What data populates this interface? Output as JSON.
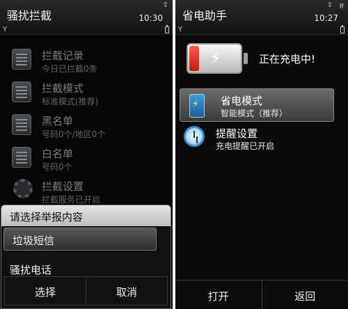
{
  "left": {
    "title": "骚扰拦截",
    "time": "10:30",
    "items": [
      {
        "title": "拦截记录",
        "subtitle": "今日已拦截0条"
      },
      {
        "title": "拦截模式",
        "subtitle": "标准模式(推荐)"
      },
      {
        "title": "黑名单",
        "subtitle": "号码0个/地区0个"
      },
      {
        "title": "白名单",
        "subtitle": "号码0个"
      },
      {
        "title": "拦截设置",
        "subtitle": "拦截服务已开启"
      }
    ],
    "popup": {
      "heading": "请选择举报内容",
      "options": [
        "垃圾短信",
        "骚扰电话"
      ],
      "selected": "垃圾短信",
      "ok": "选择",
      "cancel": "取消"
    }
  },
  "right": {
    "title": "省电助手",
    "time": "10:27",
    "charging_text": "正在充电中!",
    "items": [
      {
        "title": "省电模式",
        "subtitle": "智能模式（推荐）"
      },
      {
        "title": "提醒设置",
        "subtitle": "充电提醒已开启"
      }
    ],
    "softkeys": {
      "left": "打开",
      "right": "返回"
    }
  }
}
